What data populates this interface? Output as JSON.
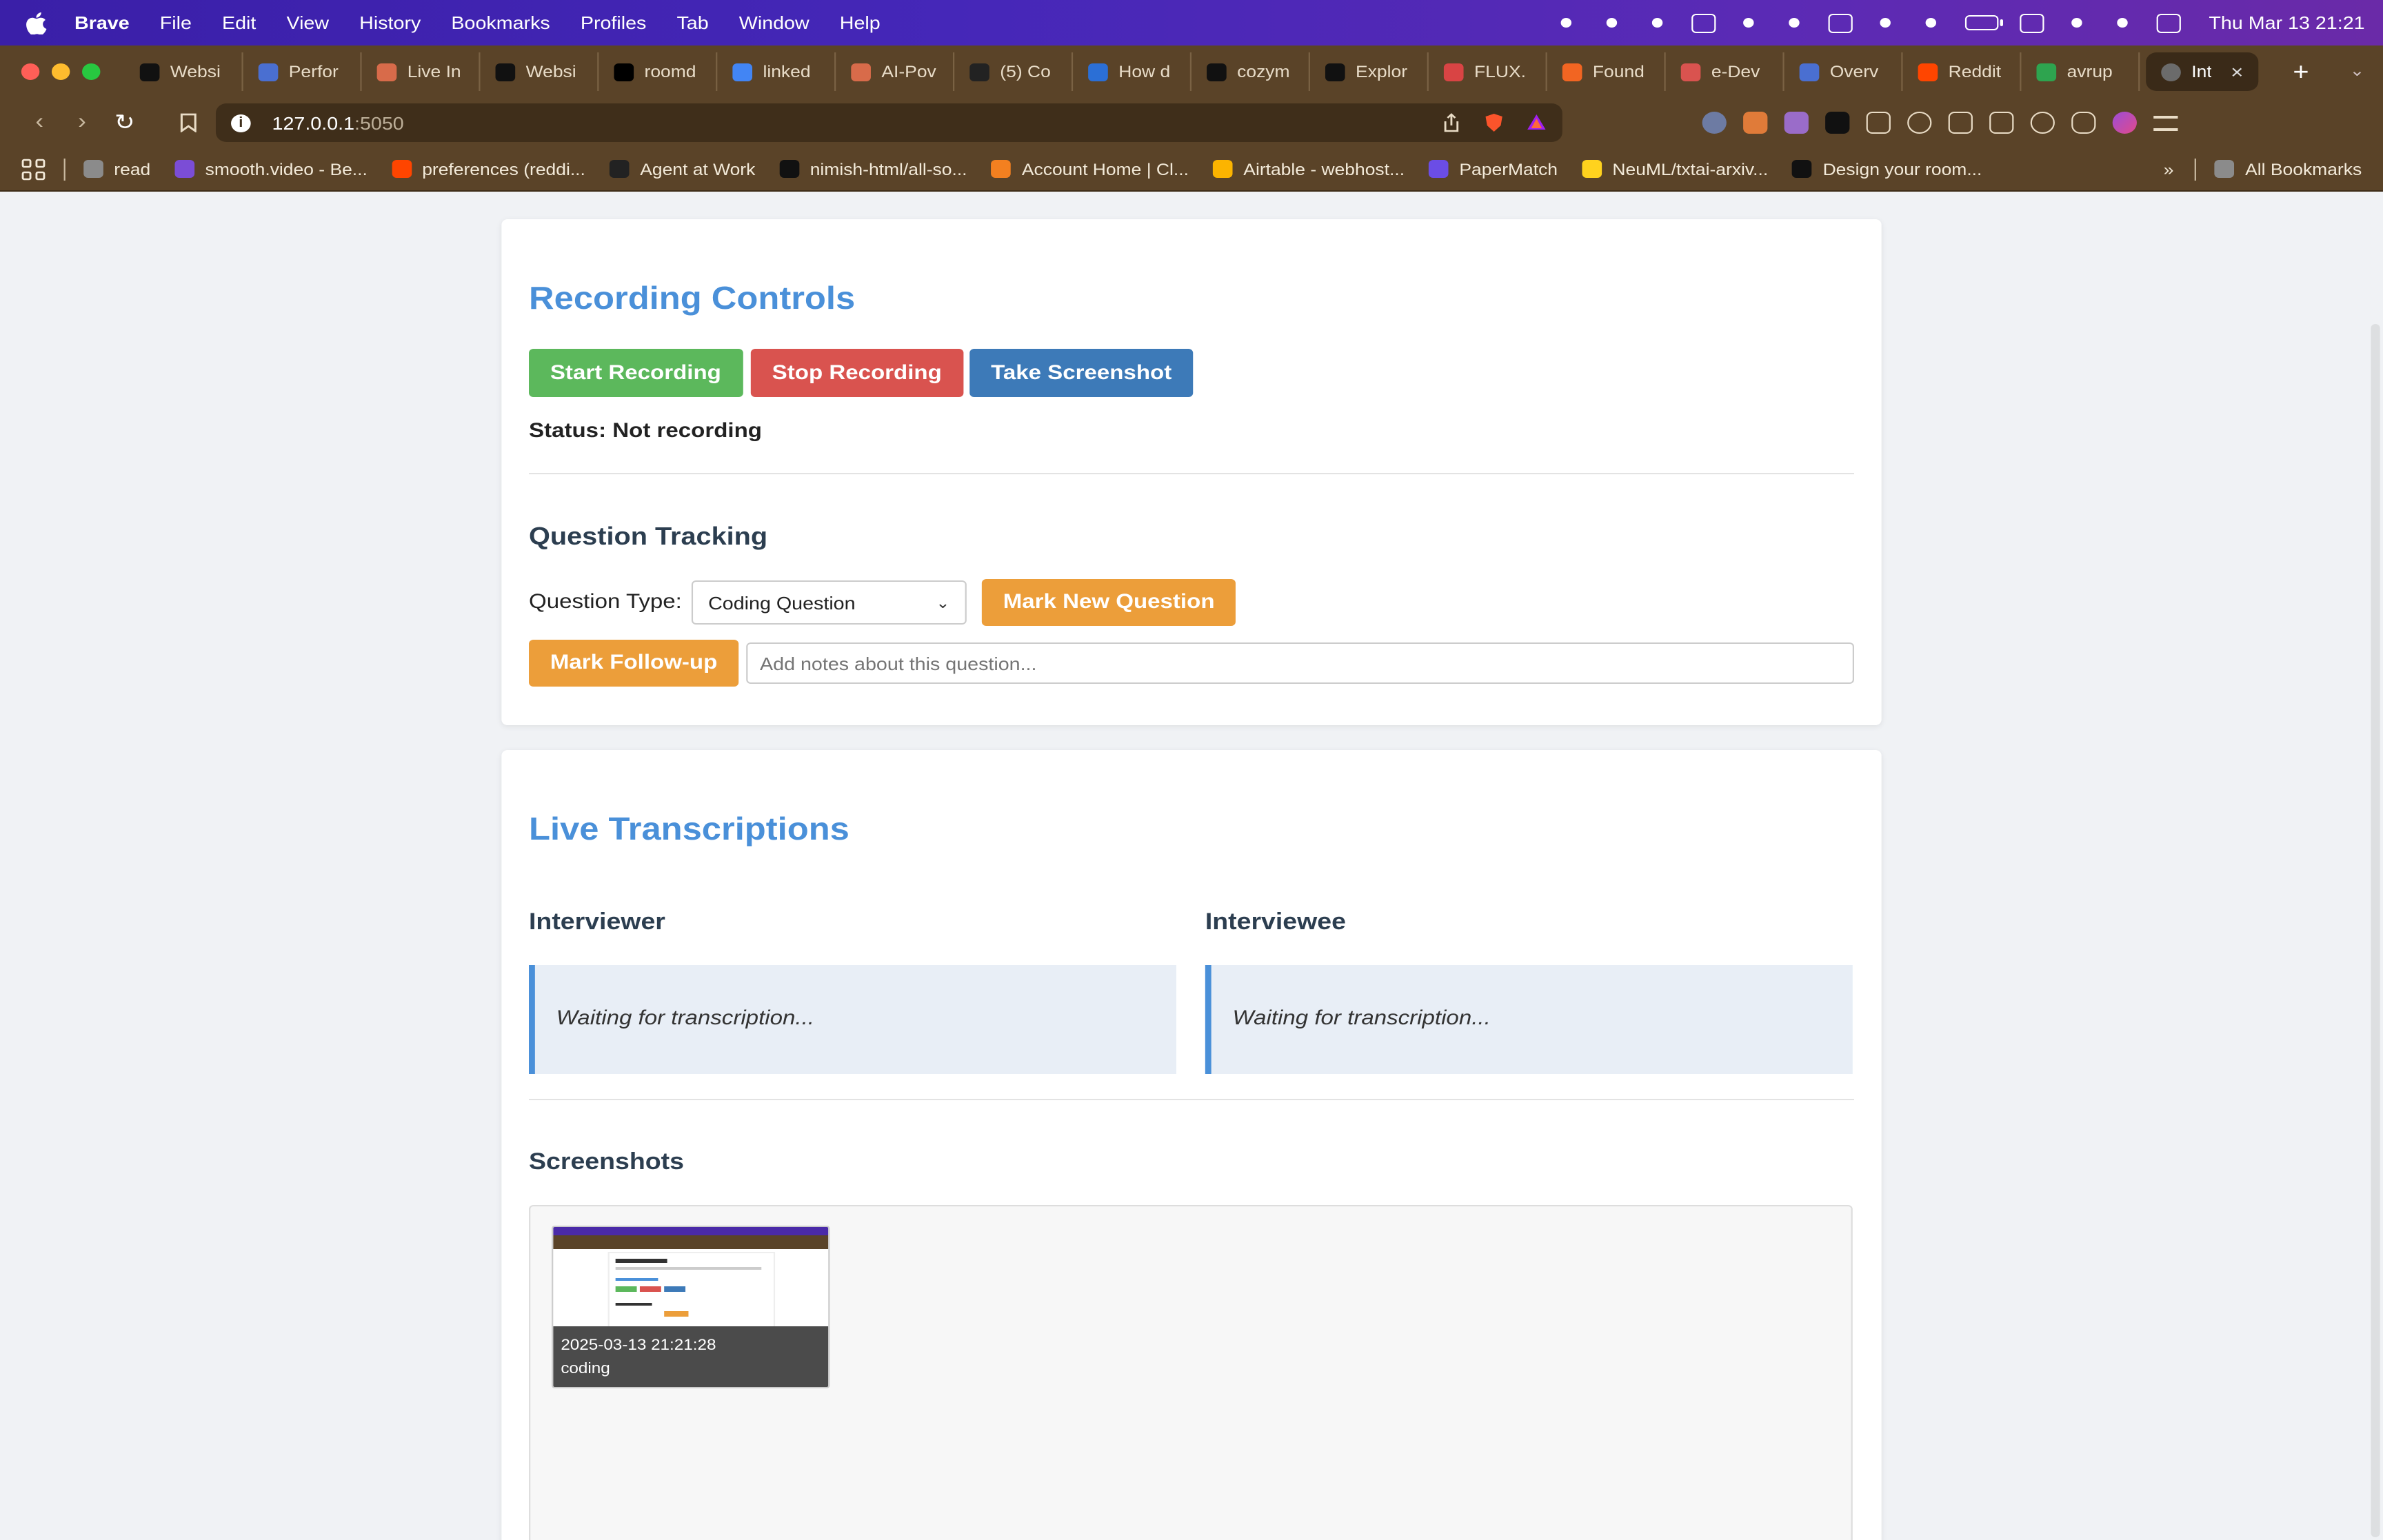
{
  "menubar": {
    "app_name": "Brave",
    "items": [
      "File",
      "Edit",
      "View",
      "History",
      "Bookmarks",
      "Profiles",
      "Tab",
      "Window",
      "Help"
    ],
    "clock": "Thu Mar 13  21:21"
  },
  "tabs": [
    {
      "label": "Websi",
      "color": "#111111"
    },
    {
      "label": "Perfor",
      "color": "#4a6fd1"
    },
    {
      "label": "Live In",
      "color": "#d86b4a"
    },
    {
      "label": "Websi",
      "color": "#111111"
    },
    {
      "label": "roomd",
      "color": "#000000"
    },
    {
      "label": "linked",
      "color": "#4285f4"
    },
    {
      "label": "AI-Pov",
      "color": "#d86b4a"
    },
    {
      "label": "(5) Co",
      "color": "#222222"
    },
    {
      "label": "How d",
      "color": "#2b6fd6"
    },
    {
      "label": "cozym",
      "color": "#111111"
    },
    {
      "label": "Explor",
      "color": "#111111"
    },
    {
      "label": "FLUX.",
      "color": "#d94444"
    },
    {
      "label": "Found",
      "color": "#f26522"
    },
    {
      "label": "e-Dev",
      "color": "#d9534f"
    },
    {
      "label": "Overv",
      "color": "#4a6fd1"
    },
    {
      "label": "Reddit",
      "color": "#ff4500"
    },
    {
      "label": "avrup",
      "color": "#2ea44f"
    }
  ],
  "active_tab": {
    "label": "Int"
  },
  "address_bar": {
    "host": "127.0.0.1",
    "port": ":5050"
  },
  "bookmarks": [
    {
      "label": "read",
      "color": "#8b8b8b"
    },
    {
      "label": "smooth.video - Be...",
      "color": "#7b4dd6"
    },
    {
      "label": "preferences (reddi...",
      "color": "#ff4500"
    },
    {
      "label": "Agent at Work",
      "color": "#222222"
    },
    {
      "label": "nimish-html/all-so...",
      "color": "#111111"
    },
    {
      "label": "Account Home | Cl...",
      "color": "#f38020"
    },
    {
      "label": "Airtable - webhost...",
      "color": "#fcb400"
    },
    {
      "label": "PaperMatch",
      "color": "#6b4de6"
    },
    {
      "label": "NeuML/txtai-arxiv...",
      "color": "#ffd21e"
    },
    {
      "label": "Design your room...",
      "color": "#111111"
    }
  ],
  "all_bookmarks": "All Bookmarks",
  "recording": {
    "title": "Recording Controls",
    "start": "Start Recording",
    "stop": "Stop Recording",
    "screenshot": "Take Screenshot",
    "status": "Status: Not recording"
  },
  "questions": {
    "title": "Question Tracking",
    "type_label": "Question Type:",
    "type_value": "Coding Question",
    "mark_new": "Mark New Question",
    "mark_followup": "Mark Follow-up",
    "notes_placeholder": "Add notes about this question..."
  },
  "transcriptions": {
    "title": "Live Transcriptions",
    "interviewer": "Interviewer",
    "interviewee": "Interviewee",
    "interviewer_text": "Waiting for transcription...",
    "interviewee_text": "Waiting for transcription..."
  },
  "screenshots": {
    "title": "Screenshots",
    "items": [
      {
        "timestamp": "2025-03-13 21:21:28",
        "tag": "coding"
      }
    ]
  },
  "colors": {
    "accent": "#4a90d9",
    "green": "#5cb85c",
    "red": "#d9534f",
    "blue": "#3d7ab8",
    "orange": "#ec9e3a"
  }
}
